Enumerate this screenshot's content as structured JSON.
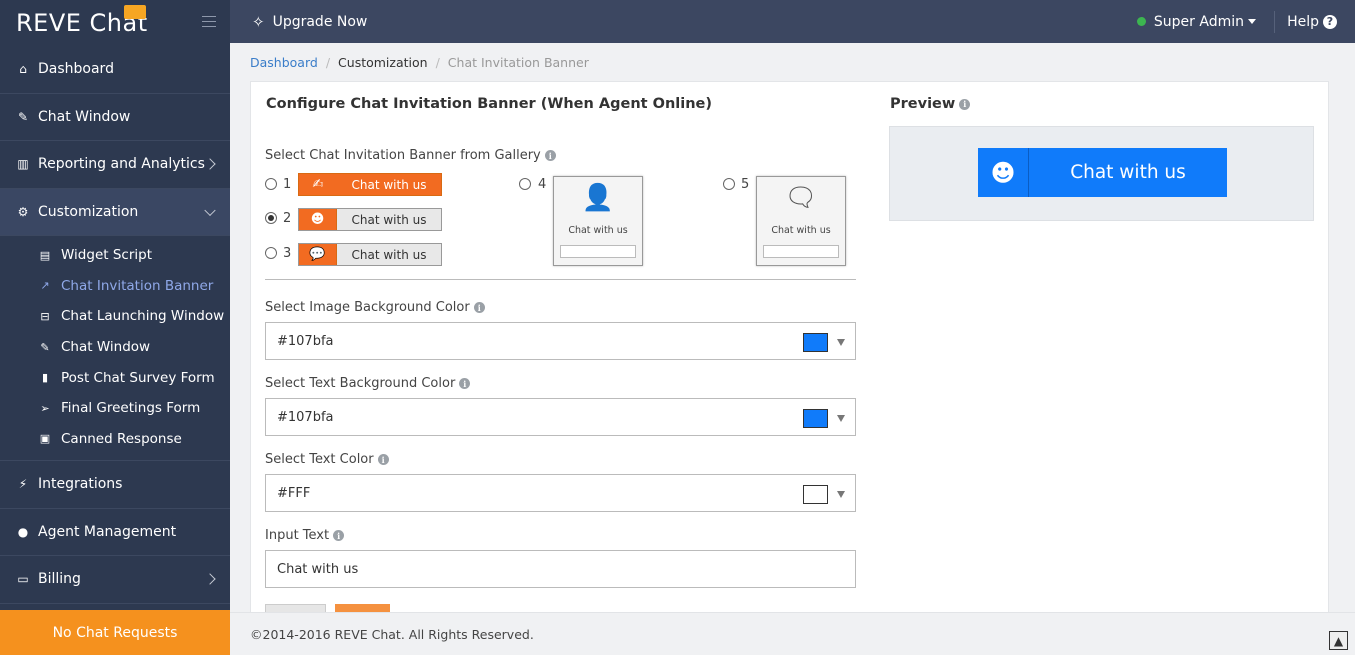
{
  "app": {
    "logo": "REVE Chat"
  },
  "topbar": {
    "upgrade_label": "Upgrade Now",
    "user_label": "Super Admin",
    "help_label": "Help"
  },
  "sidebar": {
    "items": [
      {
        "label": "Dashboard",
        "icon": "home-icon"
      },
      {
        "label": "Chat Window",
        "icon": "edit-icon"
      },
      {
        "label": "Reporting and Analytics",
        "icon": "bar-chart-icon"
      },
      {
        "label": "Customization",
        "icon": "gear-icon"
      },
      {
        "label": "Integrations",
        "icon": "plug-icon"
      },
      {
        "label": "Agent Management",
        "icon": "user-icon"
      },
      {
        "label": "Billing",
        "icon": "money-icon"
      }
    ],
    "subitems": [
      {
        "label": "Widget Script",
        "icon": "code-file-icon"
      },
      {
        "label": "Chat Invitation Banner",
        "icon": "external-link-icon"
      },
      {
        "label": "Chat Launching Window",
        "icon": "window-icon"
      },
      {
        "label": "Chat Window",
        "icon": "edit-icon"
      },
      {
        "label": "Post Chat Survey Form",
        "icon": "file-icon"
      },
      {
        "label": "Final Greetings Form",
        "icon": "send-icon"
      },
      {
        "label": "Canned Response",
        "icon": "archive-icon"
      }
    ],
    "no_chat_requests": "No Chat Requests"
  },
  "breadcrumb": {
    "home": "Dashboard",
    "section": "Customization",
    "current": "Chat Invitation Banner"
  },
  "form": {
    "title": "Configure Chat Invitation Banner (When Agent Online)",
    "gallery_label": "Select Chat Invitation Banner from Gallery",
    "gallery": [
      {
        "num": "1",
        "text": "Chat with us",
        "selected": false
      },
      {
        "num": "2",
        "text": "Chat with us",
        "selected": true
      },
      {
        "num": "3",
        "text": "Chat with us",
        "selected": false
      },
      {
        "num": "4",
        "text": "Chat with us",
        "selected": false
      },
      {
        "num": "5",
        "text": "Chat with us",
        "selected": false
      }
    ],
    "image_bg_label": "Select Image Background Color",
    "image_bg_value": "#107bfa",
    "text_bg_label": "Select Text Background Color",
    "text_bg_value": "#107bfa",
    "text_color_label": "Select Text Color",
    "text_color_value": "#FFF",
    "input_text_label": "Input Text",
    "input_text_value": "Chat with us"
  },
  "preview": {
    "title": "Preview",
    "banner_text": "Chat with us",
    "banner_color": "#107bfa"
  },
  "footer": {
    "copyright": "©2014-2016 REVE Chat. All Rights Reserved."
  }
}
